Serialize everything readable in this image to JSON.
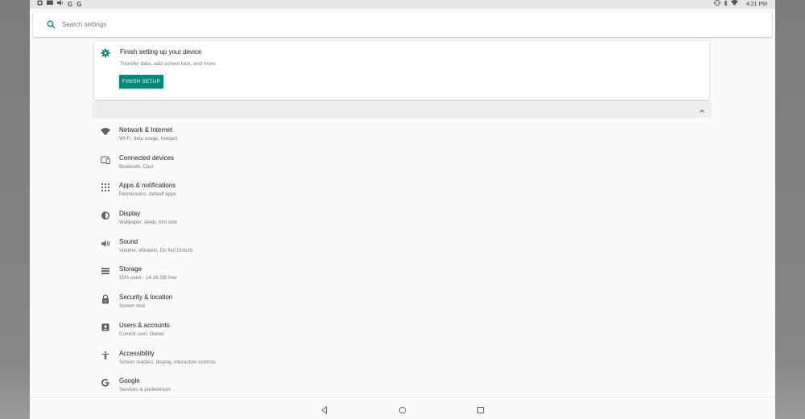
{
  "status_bar": {
    "left_icons": [
      "android-icon",
      "message-icon",
      "cast-icon",
      "google-icon",
      "google-icon"
    ],
    "right_icons": [
      "vibrate-icon",
      "bluetooth-icon",
      "wifi-icon"
    ],
    "time": "4:21 PM"
  },
  "search": {
    "placeholder": "Search settings"
  },
  "suggestion_card": {
    "title": "Finish setting up your device",
    "subtitle": "Transfer data, add screen lock, and more",
    "button_label": "FINISH SETUP",
    "accent_color": "#00897b"
  },
  "settings": [
    {
      "title": "Network & Internet",
      "subtitle": "Wi-Fi, data usage, hotspot",
      "icon": "wifi-icon"
    },
    {
      "title": "Connected devices",
      "subtitle": "Bluetooth, Cast",
      "icon": "devices-icon"
    },
    {
      "title": "Apps & notifications",
      "subtitle": "Permissions, default apps",
      "icon": "apps-icon"
    },
    {
      "title": "Display",
      "subtitle": "Wallpaper, sleep, font size",
      "icon": "brightness-icon"
    },
    {
      "title": "Sound",
      "subtitle": "Volume, vibration, Do Not Disturb",
      "icon": "volume-icon"
    },
    {
      "title": "Storage",
      "subtitle": "55% used - 14.34 GB free",
      "icon": "storage-icon"
    },
    {
      "title": "Security & location",
      "subtitle": "Screen lock",
      "icon": "lock-icon"
    },
    {
      "title": "Users & accounts",
      "subtitle": "Current user: Owner",
      "icon": "account-icon"
    },
    {
      "title": "Accessibility",
      "subtitle": "Screen readers, display, interaction controls",
      "icon": "accessibility-icon"
    },
    {
      "title": "Google",
      "subtitle": "Services & preferences",
      "icon": "google-icon"
    }
  ],
  "nav_bar": {
    "buttons": [
      "back-icon",
      "home-icon",
      "recents-icon"
    ]
  }
}
